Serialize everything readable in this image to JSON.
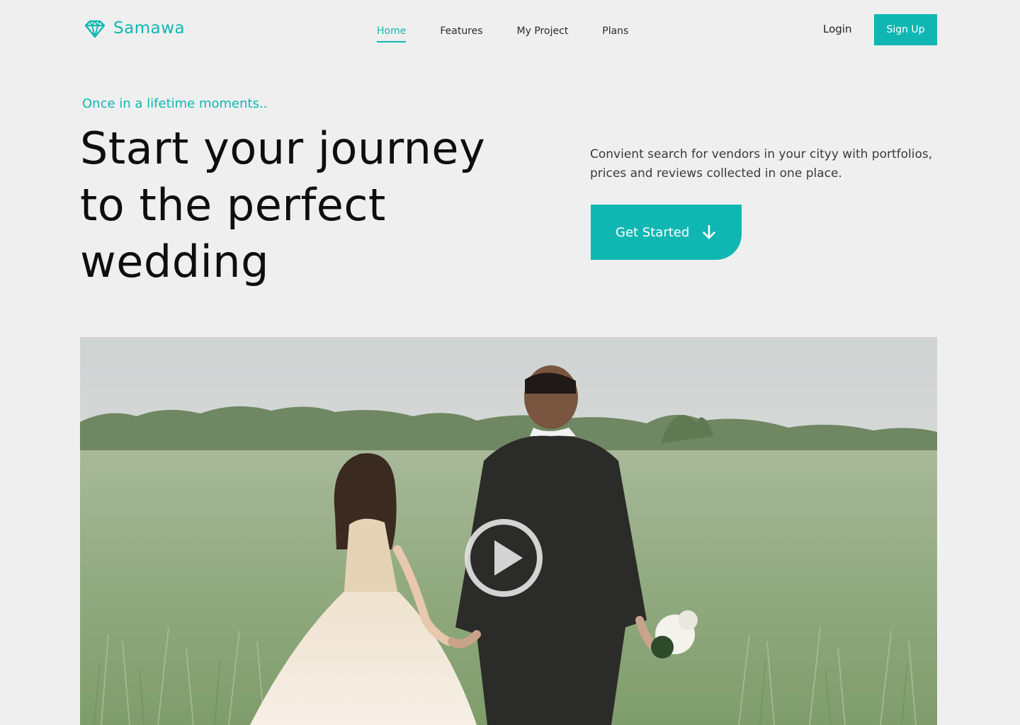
{
  "brand": {
    "name": "Samawa",
    "logo_icon": "diamond-icon"
  },
  "nav": {
    "items": [
      "Home",
      "Features",
      "My Project",
      "Plans"
    ],
    "active": "Home"
  },
  "header": {
    "login_label": "Login",
    "signup_label": "Sign Up"
  },
  "hero": {
    "eyebrow": "Once in a lifetime moments..",
    "title_line1": "Start your journey",
    "title_line2": "to the perfect",
    "title_line3": "wedding",
    "description": "Convient search for vendors in your cityy with portfolios, prices and reviews collected in one place.",
    "cta_label": "Get Started",
    "cta_icon": "arrow-down-icon"
  },
  "media": {
    "play_icon": "play-icon"
  },
  "colors": {
    "accent": "#10b7b2",
    "background": "#efefef",
    "text": "#0e0e0e"
  }
}
